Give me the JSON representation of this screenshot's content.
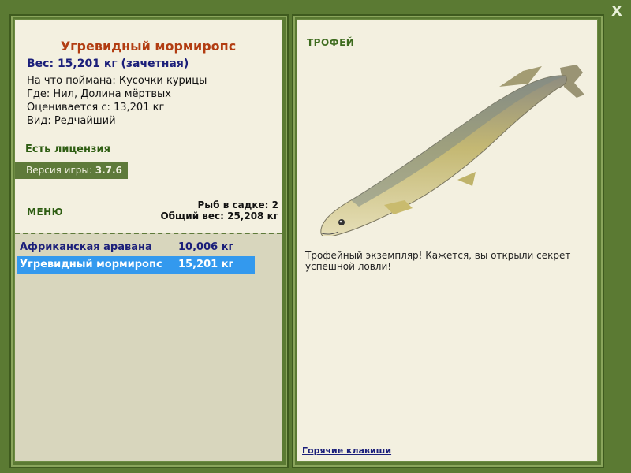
{
  "fish": {
    "title": "Угревидный мормиропс",
    "weight": "Вес: 15,201 кг (зачетная)",
    "caught_with": "На что поймана: Кусочки курицы",
    "location": "Где: Нил, Долина мёртвых",
    "rated_from": "Оценивается с: 13,201 кг",
    "rarity": "Вид: Редчайший"
  },
  "license": "Есть лицензия",
  "version": {
    "label": "Версия игры:",
    "value": "3.7.6"
  },
  "menu_label": "МЕНЮ",
  "stats": {
    "fish_in_keepnet": "Рыб в садке: 2",
    "total_weight": "Общий вес: 25,208 кг"
  },
  "catch_list": [
    {
      "name": "Африканская аравана",
      "weight": "10,006 кг",
      "selected": false
    },
    {
      "name": "Угревидный мормиропс",
      "weight": "15,201 кг",
      "selected": true
    }
  ],
  "trophy": {
    "label": "ТРОФЕЙ",
    "description": "Трофейный экземпляр! Кажется, вы открыли секрет успешной ловли!"
  },
  "hotkeys_link": "Горячие клавиши",
  "close_label": "X"
}
